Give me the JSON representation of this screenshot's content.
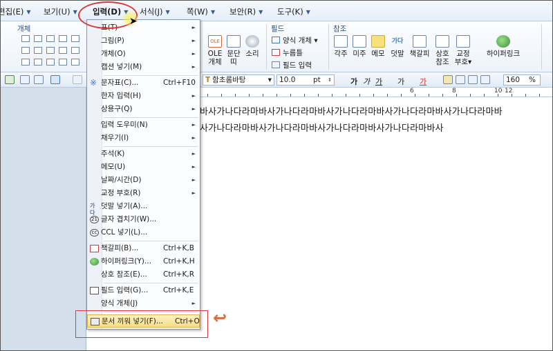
{
  "menubar": {
    "items": [
      {
        "label": "편집(E)"
      },
      {
        "label": "보기(U)"
      },
      {
        "label": "입력(D)"
      },
      {
        "label": "서식(J)"
      },
      {
        "label": "쪽(W)"
      },
      {
        "label": "보안(R)"
      },
      {
        "label": "도구(K)"
      }
    ]
  },
  "ribbon": {
    "groups": [
      "개체",
      "필드",
      "참조"
    ],
    "buttons": {
      "ole": "OLE",
      "ole_sub": "개체",
      "paragraph": "문단",
      "paragraph_sub": "띠",
      "sound": "소리",
      "form_object": "양식 개체",
      "pressure": "누름틀",
      "field_input": "필드 입력",
      "footnote": "각주",
      "endnote": "미주",
      "memo": "메모",
      "annotation": "덧말",
      "bookmark": "책갈피",
      "cross_ref": "상호",
      "cross_ref_sub": "참조",
      "proof": "교정",
      "proof_sub": "부호",
      "hyperlink": "하이퍼링크",
      "annotation_icon_text": "가다"
    }
  },
  "toolbar": {
    "font_name": "함초롬바탕",
    "font_size": "10.0",
    "font_unit": "pt",
    "zoom": "160",
    "zoom_unit": "%"
  },
  "ruler": {
    "numbers": [
      "6",
      "8",
      "10",
      "12"
    ]
  },
  "document": {
    "line1": "바사가나다라마바사가나다라마바사가나다라마바사가나다라마바사가나다라마바",
    "line2": "사가나다라마바사가나다라마바사가나다라마바사가나다라마바사"
  },
  "dropdown": {
    "items": [
      {
        "label": "표(T)",
        "shortcut": "",
        "submenu": true
      },
      {
        "label": "그림(P)",
        "shortcut": "",
        "submenu": true
      },
      {
        "label": "개체(O)",
        "shortcut": "",
        "submenu": true
      },
      {
        "label": "캡션 넣기(M)",
        "shortcut": "",
        "submenu": true
      },
      {
        "label": "문자표(C)...",
        "shortcut": "Ctrl+F10",
        "submenu": false
      },
      {
        "label": "한자 입력(H)",
        "shortcut": "",
        "submenu": true
      },
      {
        "label": "상용구(Q)",
        "shortcut": "",
        "submenu": true
      },
      {
        "label": "입력 도우미(N)",
        "shortcut": "",
        "submenu": true
      },
      {
        "label": "채우기(I)",
        "shortcut": "",
        "submenu": true
      },
      {
        "label": "주석(K)",
        "shortcut": "",
        "submenu": true
      },
      {
        "label": "메모(U)",
        "shortcut": "",
        "submenu": true
      },
      {
        "label": "날짜/시간(D)",
        "shortcut": "",
        "submenu": true
      },
      {
        "label": "교정 부호(R)",
        "shortcut": "",
        "submenu": true
      },
      {
        "label": "덧말 넣기(A)...",
        "shortcut": "",
        "submenu": false
      },
      {
        "label": "글자 겹치기(W)...",
        "shortcut": "",
        "submenu": false
      },
      {
        "label": "CCL 넣기(L)...",
        "shortcut": "",
        "submenu": false
      },
      {
        "label": "책갈피(B)...",
        "shortcut": "Ctrl+K,B",
        "submenu": false
      },
      {
        "label": "하이퍼링크(Y)...",
        "shortcut": "Ctrl+K,H",
        "submenu": false
      },
      {
        "label": "상호 참조(E)...",
        "shortcut": "Ctrl+K,R",
        "submenu": false
      },
      {
        "label": "필드 입력(G)...",
        "shortcut": "Ctrl+K,E",
        "submenu": false
      },
      {
        "label": "양식 개체(J)",
        "shortcut": "",
        "submenu": true
      },
      {
        "label": "문서 끼워 넣기(F)...",
        "shortcut": "Ctrl+O",
        "submenu": false
      }
    ]
  },
  "colors": {
    "highlight_red": "#d63a3a",
    "accent_orange": "#e06a3c",
    "menu_hover": "#f6dd85"
  }
}
